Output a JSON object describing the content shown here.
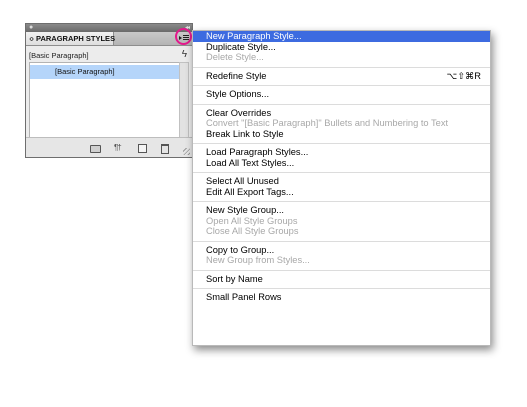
{
  "panel": {
    "close_glyph": "●",
    "collapse_glyph": "◂◂",
    "tab_toggle": "≎",
    "tab_title": "PARAGRAPH STYLES",
    "current_style": "[Basic Paragraph]",
    "lightning_glyph": "ϟ",
    "list_items": [
      "[Basic Paragraph]"
    ],
    "footer": {
      "clear_glyph": "¶†"
    }
  },
  "menu": {
    "items": [
      {
        "label": "New Paragraph Style...",
        "state": "selected"
      },
      {
        "label": "Duplicate Style...",
        "state": "enabled"
      },
      {
        "label": "Delete Style...",
        "state": "disabled"
      },
      {
        "label": "Redefine Style",
        "state": "enabled",
        "shortcut": "⌥⇧⌘R"
      },
      {
        "label": "Style Options...",
        "state": "enabled"
      },
      {
        "label": "Clear Overrides",
        "state": "enabled"
      },
      {
        "label": "Convert \"[Basic Paragraph]\" Bullets and Numbering to Text",
        "state": "disabled"
      },
      {
        "label": "Break Link to Style",
        "state": "enabled"
      },
      {
        "label": "Load Paragraph Styles...",
        "state": "enabled"
      },
      {
        "label": "Load All Text Styles...",
        "state": "enabled"
      },
      {
        "label": "Select All Unused",
        "state": "enabled"
      },
      {
        "label": "Edit All Export Tags...",
        "state": "enabled"
      },
      {
        "label": "New Style Group...",
        "state": "enabled"
      },
      {
        "label": "Open All Style Groups",
        "state": "disabled"
      },
      {
        "label": "Close All Style Groups",
        "state": "disabled"
      },
      {
        "label": "Copy to Group...",
        "state": "enabled"
      },
      {
        "label": "New Group from Styles...",
        "state": "disabled"
      },
      {
        "label": "Sort by Name",
        "state": "enabled"
      },
      {
        "label": "Small Panel Rows",
        "state": "enabled"
      }
    ]
  },
  "colors": {
    "selection": "#3d6be0",
    "list_selection": "#b5d5fa",
    "callout_ring": "#e3198c",
    "disabled_text": "#a8a8a8"
  }
}
